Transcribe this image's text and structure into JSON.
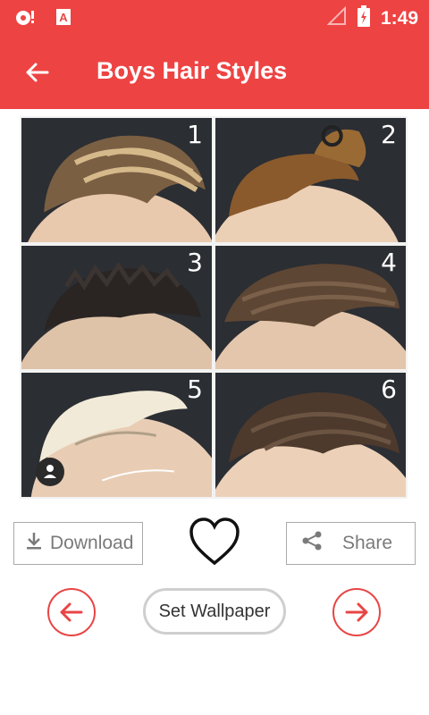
{
  "status_bar": {
    "time": "1:49",
    "icons": [
      "notification-icon",
      "app-a-icon",
      "signal-icon",
      "battery-icon"
    ]
  },
  "app_bar": {
    "title": "Boys Hair Styles",
    "back_icon": "arrow-left-icon"
  },
  "gallery": {
    "tiles": [
      "1",
      "2",
      "3",
      "4",
      "5",
      "6"
    ]
  },
  "actions": {
    "download_label": "Download",
    "share_label": "Share",
    "favorite_icon": "heart-icon",
    "set_wallpaper_label": "Set Wallpaper",
    "prev_icon": "arrow-left-circle-icon",
    "next_icon": "arrow-right-circle-icon"
  },
  "colors": {
    "accent": "#ee4343",
    "button_border": "#aaaaaa",
    "circle_border": "#e84545"
  }
}
